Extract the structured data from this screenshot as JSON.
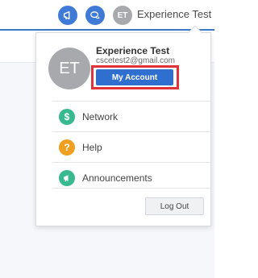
{
  "header": {
    "user_initials": "ET",
    "user_name": "Experience Test"
  },
  "dropdown": {
    "initials": "ET",
    "name": "Experience Test",
    "email": "cscetest2@gmail.com",
    "my_account_label": "My Account",
    "items": [
      {
        "label": "Network",
        "icon": "dollar-icon",
        "color": "#39b98f"
      },
      {
        "label": "Help",
        "icon": "question-icon",
        "color": "#f0a020"
      },
      {
        "label": "Announcements",
        "icon": "megaphone-icon",
        "color": "#39b98f"
      }
    ],
    "logout_label": "Log Out"
  },
  "colors": {
    "accent": "#3f7bd6",
    "highlight": "#e0323b",
    "button_blue": "#2f6fd0"
  }
}
